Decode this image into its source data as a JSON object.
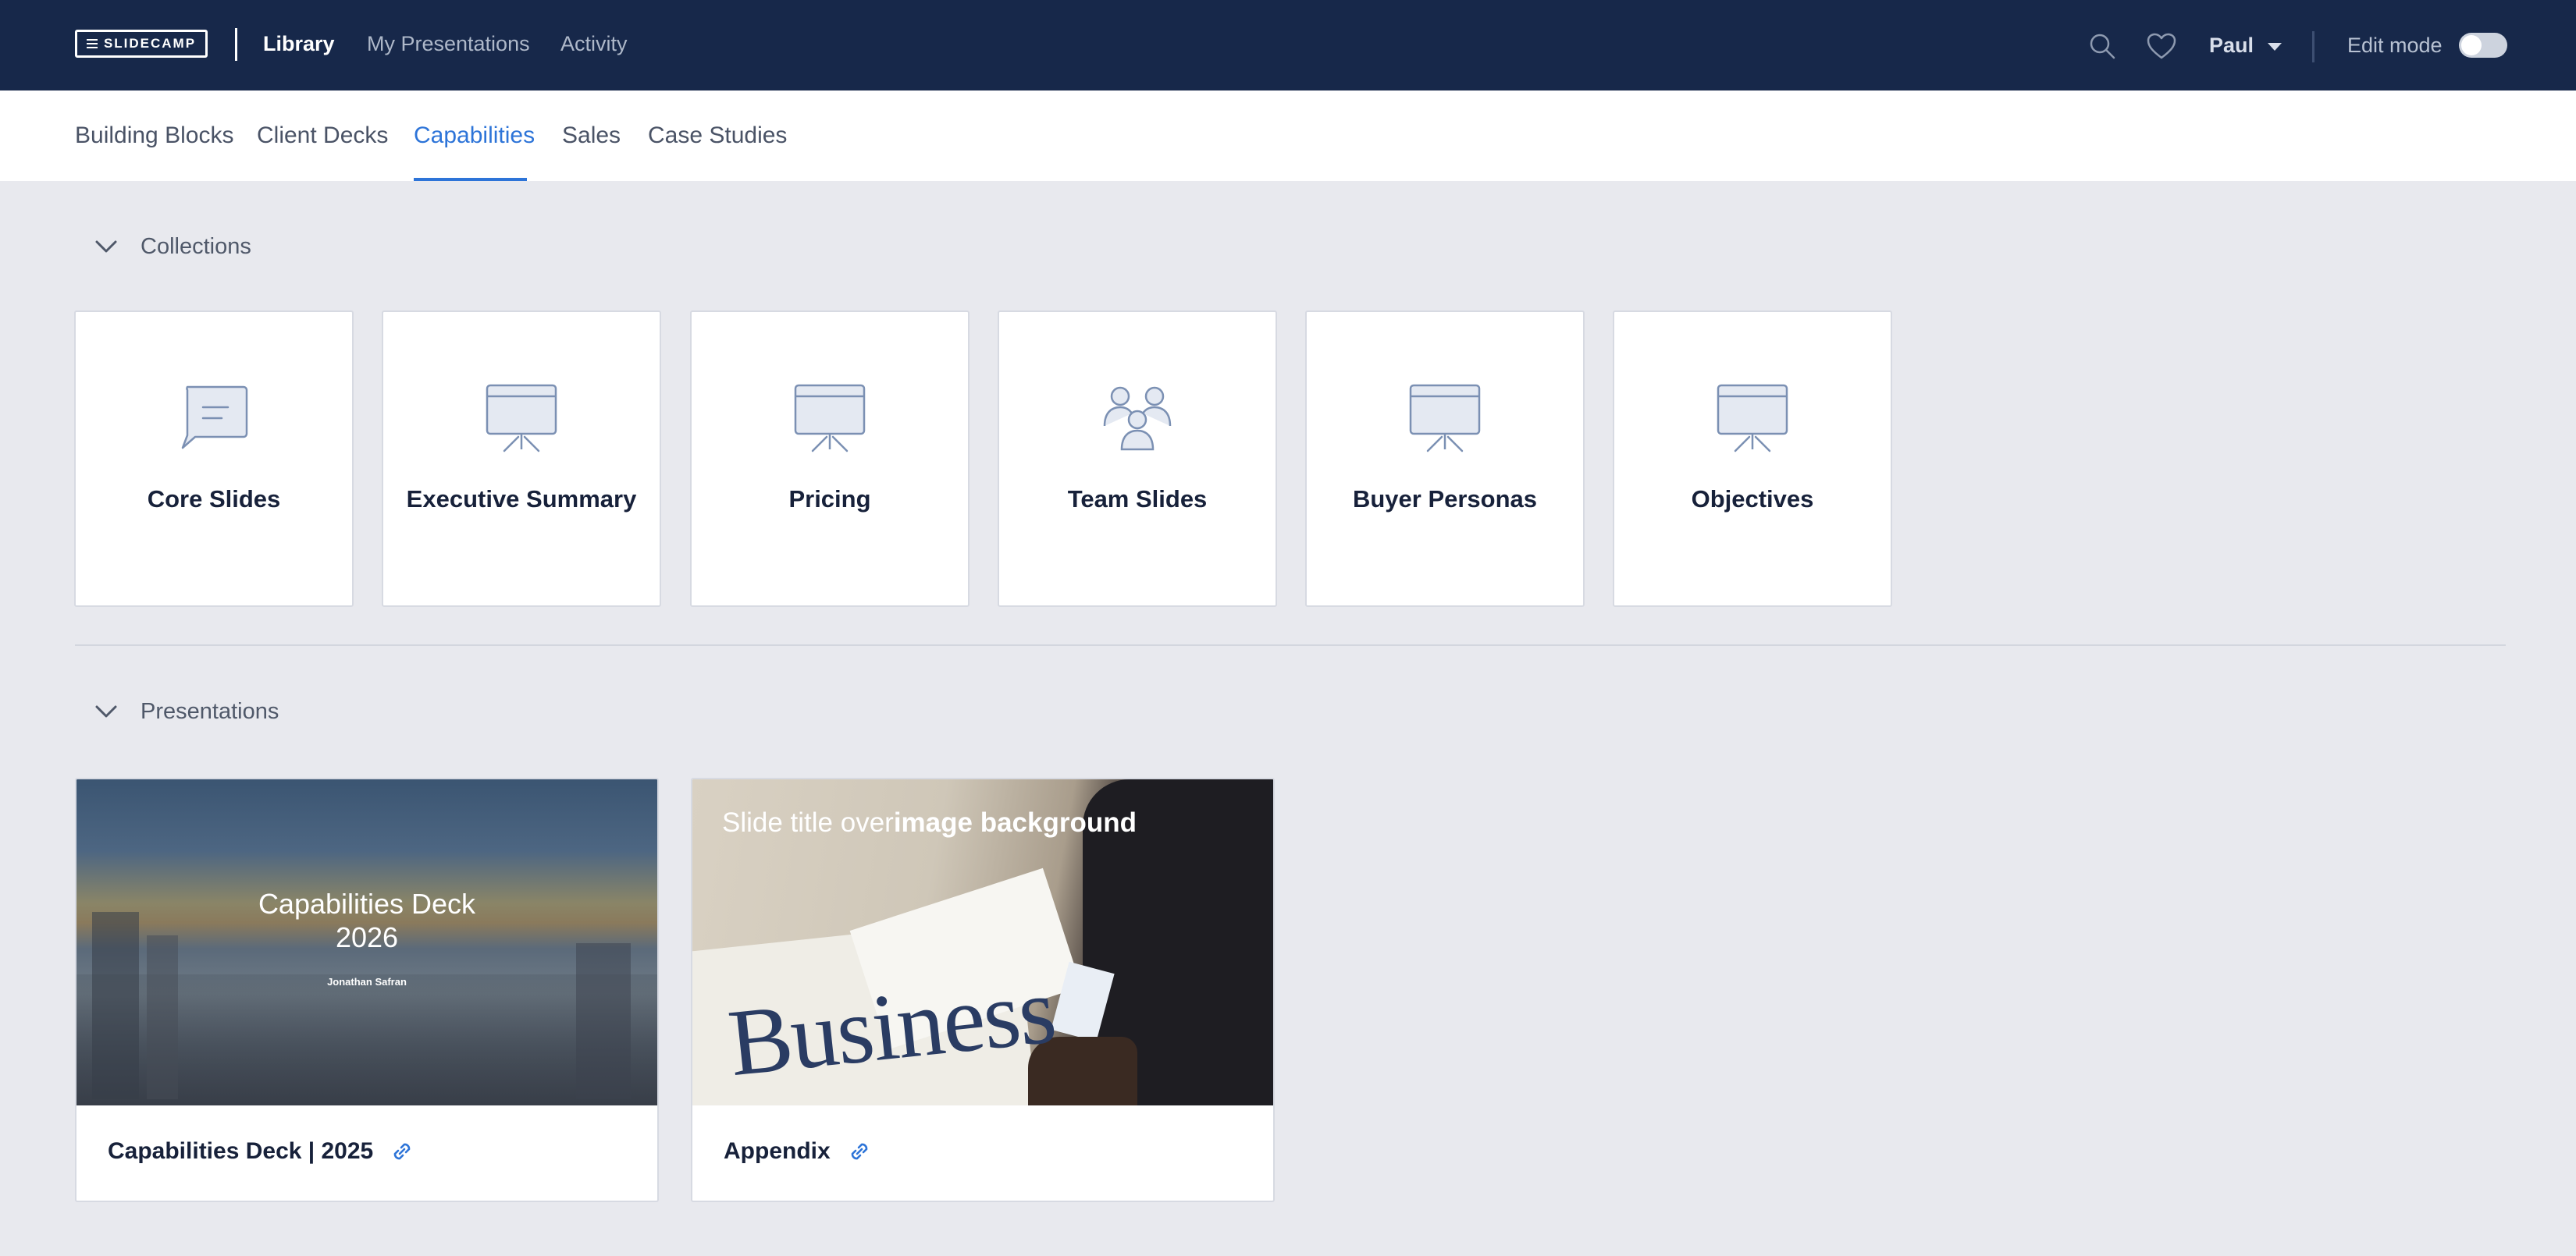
{
  "topbar": {
    "logo_text": "SLIDECAMP",
    "nav": [
      {
        "label": "Library",
        "active": true
      },
      {
        "label": "My Presentations",
        "active": false
      },
      {
        "label": "Activity",
        "active": false
      }
    ],
    "icons": [
      "search-icon",
      "heart-icon"
    ],
    "user_name": "Paul",
    "edit_mode_label": "Edit mode",
    "edit_mode_on": false
  },
  "subnav": {
    "tabs": [
      {
        "label": "Building Blocks",
        "active": false
      },
      {
        "label": "Client Decks",
        "active": false
      },
      {
        "label": "Capabilities",
        "active": true
      },
      {
        "label": "Sales",
        "active": false
      },
      {
        "label": "Case Studies",
        "active": false
      }
    ]
  },
  "collections": {
    "header": "Collections",
    "items": [
      {
        "label": "Core Slides",
        "icon": "speech-bubble-icon"
      },
      {
        "label": "Executive Summary",
        "icon": "presentation-board-icon"
      },
      {
        "label": "Pricing",
        "icon": "presentation-board-icon"
      },
      {
        "label": "Team Slides",
        "icon": "team-icon"
      },
      {
        "label": "Buyer Personas",
        "icon": "presentation-board-icon"
      },
      {
        "label": "Objectives",
        "icon": "presentation-board-icon"
      }
    ]
  },
  "presentations": {
    "header": "Presentations",
    "items": [
      {
        "title": "Capabilities Deck | 2025",
        "thumb_title_line1": "Capabilities Deck",
        "thumb_title_line2": "2026",
        "thumb_author": "Jonathan Safran"
      },
      {
        "title": "Appendix",
        "thumb_title_plain": "Slide title over",
        "thumb_title_bold": "image background",
        "thumb_word": "Business"
      }
    ]
  },
  "colors": {
    "navbar": "#17284a",
    "accent": "#2d74d8",
    "background": "#e8e9ee",
    "icon_stroke": "#7b90b3"
  }
}
